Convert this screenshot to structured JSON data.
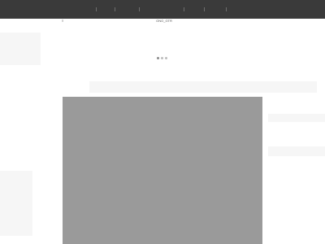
{
  "nav": {
    "items": [
      "",
      "",
      "",
      "",
      "",
      ""
    ]
  },
  "header": {
    "small_label": "ONO_GTR"
  },
  "carousel": {
    "dot_count": 3,
    "active_index": 0
  },
  "media": {
    "placeholder_color": "#9a9a9a"
  },
  "colors": {
    "topbar": "#3a3a3a",
    "background": "#ffffff"
  }
}
